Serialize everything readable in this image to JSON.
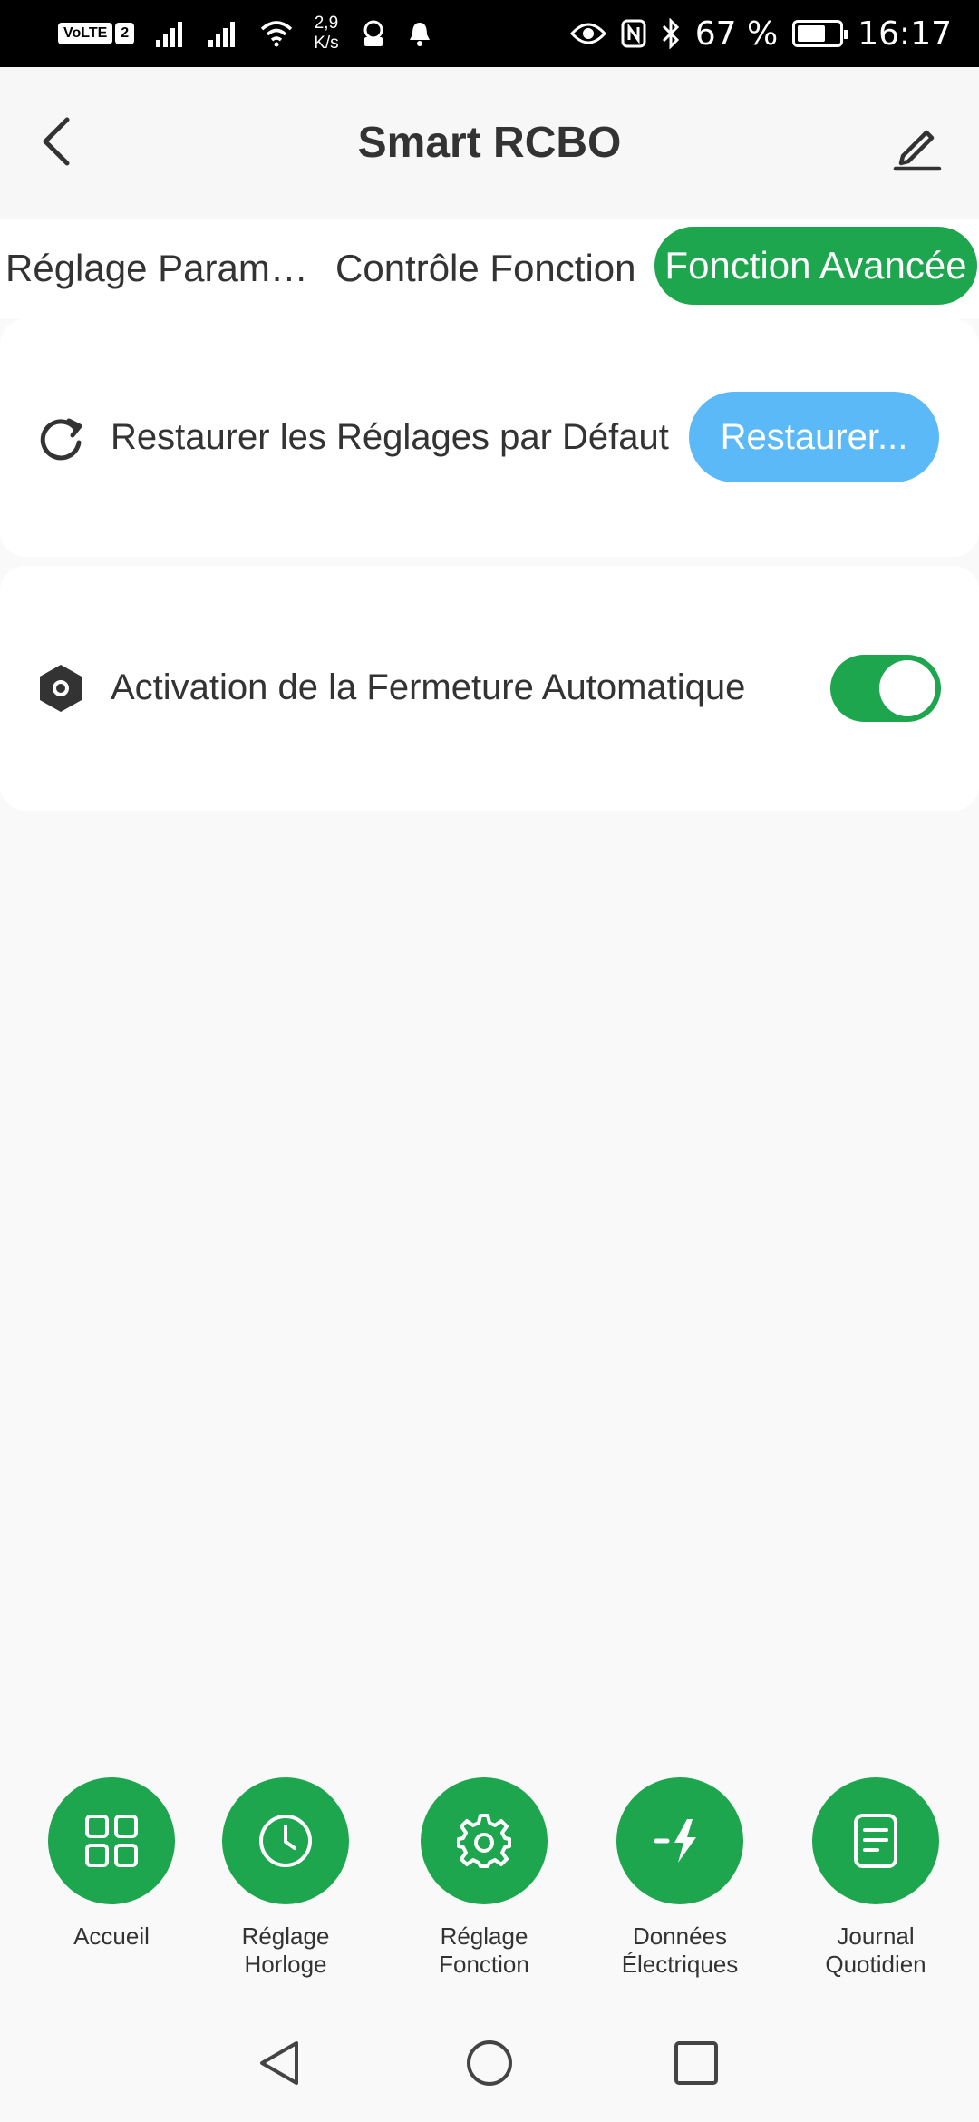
{
  "status_bar": {
    "volte_label": "VoLTE",
    "sim_number": "2",
    "net_speed_value": "2,9",
    "net_speed_unit": "K/s",
    "battery_percent": "67 %",
    "battery_level": 0.67,
    "time": "16:17"
  },
  "header": {
    "title": "Smart RCBO",
    "back_icon": "chevron-left-icon",
    "edit_icon": "pencil-icon"
  },
  "tabs": [
    {
      "label": "Réglage Paramètres",
      "active": false
    },
    {
      "label": "Contrôle Fonction",
      "active": false
    },
    {
      "label": "Fonction Avancée",
      "active": true
    }
  ],
  "settings": {
    "restore": {
      "icon": "refresh-icon",
      "label": "Restaurer les Réglages par Défaut",
      "button_label": "Restaurer..."
    },
    "auto_close": {
      "icon": "hexagon-nut-icon",
      "label": "Activation de la Fermeture Automatique",
      "enabled": true
    }
  },
  "bottom_nav": [
    {
      "label": "Accueil",
      "icon": "grid-icon"
    },
    {
      "label": "Réglage\nHorloge",
      "icon": "clock-icon"
    },
    {
      "label": "Réglage\nFonction",
      "icon": "gear-icon"
    },
    {
      "label": "Données\nÉlectriques",
      "icon": "lightning-icon"
    },
    {
      "label": "Journal\nQuotidien",
      "icon": "document-icon"
    }
  ],
  "colors": {
    "accent_green": "#1ea64f",
    "restore_blue": "#5bb9f8",
    "text_dark": "#333333"
  }
}
